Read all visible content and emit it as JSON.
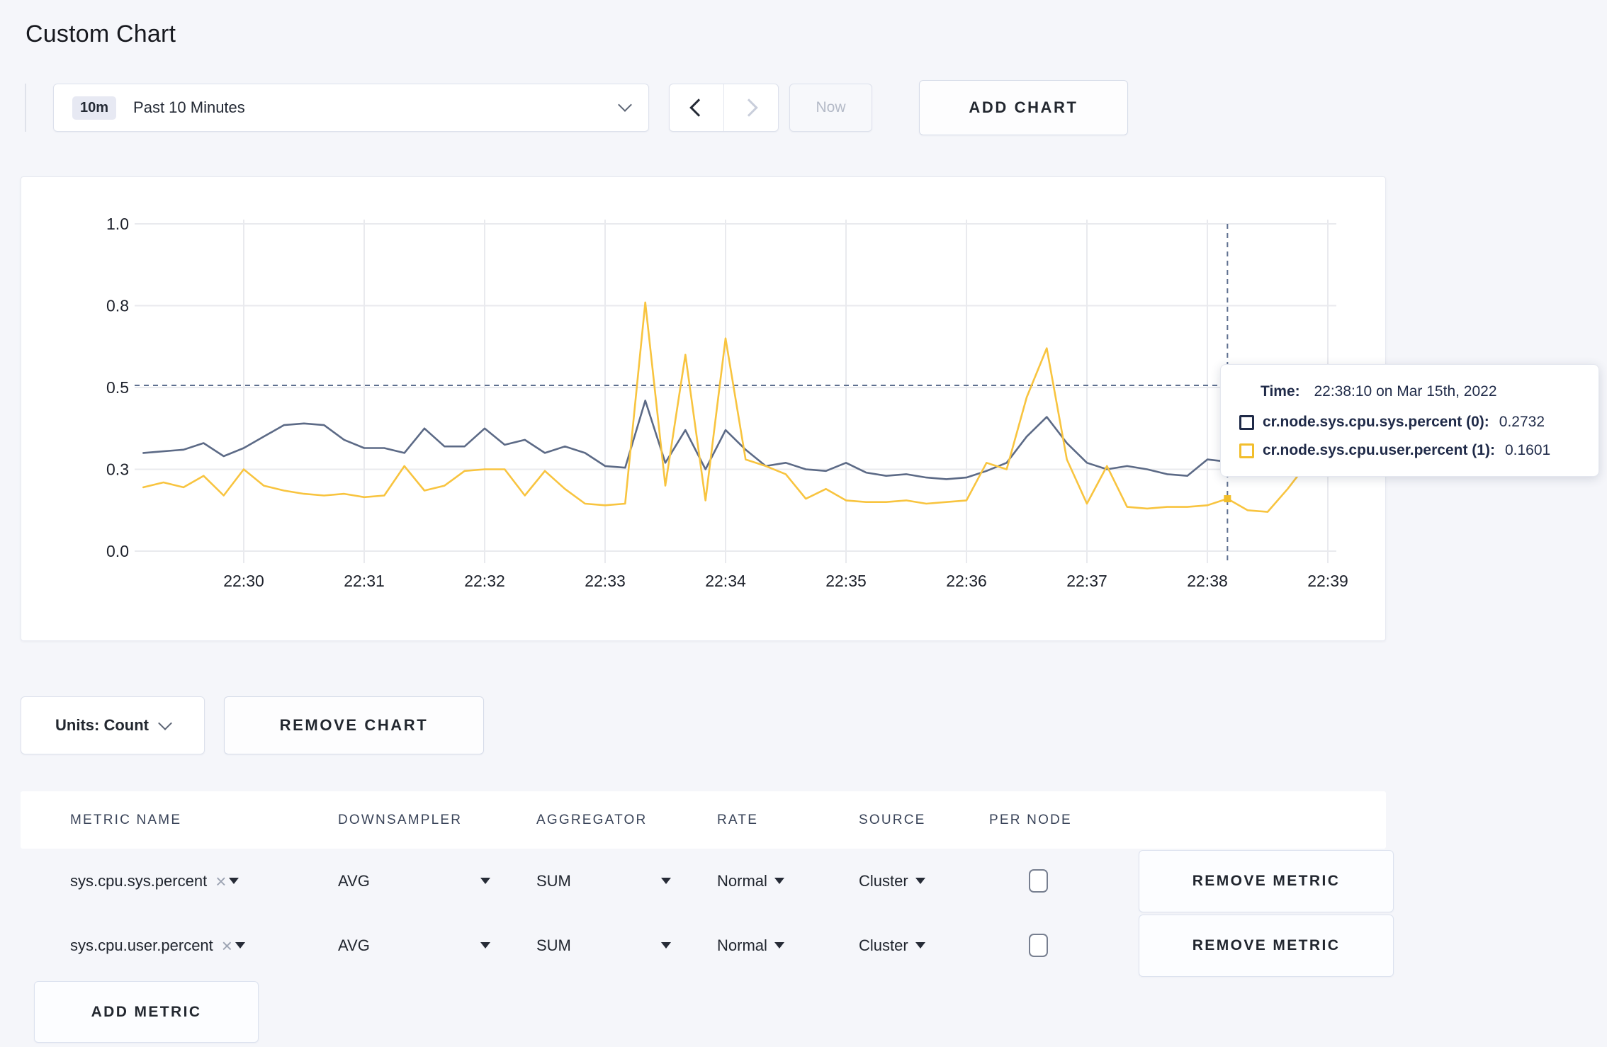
{
  "page": {
    "title": "Custom Chart"
  },
  "colors": {
    "accent_blue": "#2A5CF4",
    "series_sys_line": "#5C6A86",
    "series_sys_legend": "#1F2A48",
    "series_user_line": "#F8C43F",
    "series_user_legend": "#F2BE2C",
    "gridline": "#e9eaee",
    "crosshair": "#5f7090"
  },
  "toolbar": {
    "time_window_badge": "10m",
    "time_window_label": "Past 10 Minutes",
    "prev_icon_name": "chevron-left-icon",
    "next_icon_name": "chevron-right-icon",
    "now_label": "Now",
    "add_chart_label": "ADD CHART"
  },
  "chart": {
    "tooltip": {
      "time_label": "Time:",
      "time_value": "22:38:10 on Mar 15th, 2022",
      "series": [
        {
          "name": "cr.node.sys.cpu.sys.percent (0):",
          "value": "0.2732",
          "color": "#1F2A48"
        },
        {
          "name": "cr.node.sys.cpu.user.percent (1):",
          "value": "0.1601",
          "color": "#F2BE2C"
        }
      ]
    }
  },
  "chart_data": {
    "type": "line",
    "title": "",
    "xlabel": "",
    "ylabel": "",
    "grid": true,
    "legend_position": "tooltip",
    "x_start": "22:29:10",
    "x_interval_seconds": 10,
    "x_first_tick_offset_seconds": 50,
    "x_tick_labels": [
      "22:30",
      "22:31",
      "22:32",
      "22:33",
      "22:34",
      "22:35",
      "22:36",
      "22:37",
      "22:38",
      "22:39"
    ],
    "y_axis": {
      "range": [
        0.0,
        1.0
      ],
      "tick_labels": [
        "1.0",
        "0.8",
        "0.5",
        "0.3",
        "0.0"
      ],
      "tick_values": [
        1.0,
        0.75,
        0.5,
        0.25,
        0.0
      ]
    },
    "series": [
      {
        "name": "cr.node.sys.cpu.sys.percent",
        "color": "#5C6A86",
        "values": [
          0.3,
          0.305,
          0.31,
          0.33,
          0.29,
          0.315,
          0.35,
          0.385,
          0.39,
          0.385,
          0.34,
          0.315,
          0.315,
          0.3,
          0.375,
          0.32,
          0.32,
          0.375,
          0.325,
          0.34,
          0.3,
          0.32,
          0.3,
          0.26,
          0.255,
          0.46,
          0.27,
          0.37,
          0.25,
          0.37,
          0.31,
          0.26,
          0.27,
          0.25,
          0.245,
          0.27,
          0.24,
          0.23,
          0.235,
          0.225,
          0.22,
          0.225,
          0.245,
          0.27,
          0.35,
          0.41,
          0.33,
          0.27,
          0.25,
          0.26,
          0.25,
          0.235,
          0.23,
          0.28,
          0.2732,
          0.265,
          0.27,
          0.28,
          0.29,
          0.3
        ]
      },
      {
        "name": "cr.node.sys.cpu.user.percent",
        "color": "#F8C43F",
        "values": [
          0.195,
          0.21,
          0.195,
          0.23,
          0.17,
          0.25,
          0.2,
          0.185,
          0.175,
          0.17,
          0.175,
          0.165,
          0.17,
          0.26,
          0.185,
          0.2,
          0.245,
          0.25,
          0.25,
          0.17,
          0.245,
          0.19,
          0.145,
          0.14,
          0.145,
          0.76,
          0.2,
          0.6,
          0.155,
          0.65,
          0.28,
          0.26,
          0.235,
          0.16,
          0.19,
          0.155,
          0.15,
          0.15,
          0.155,
          0.145,
          0.15,
          0.155,
          0.27,
          0.25,
          0.47,
          0.62,
          0.28,
          0.145,
          0.26,
          0.135,
          0.13,
          0.135,
          0.135,
          0.14,
          0.1601,
          0.125,
          0.12,
          0.19,
          0.27,
          0.24
        ]
      }
    ],
    "crosshair": {
      "time": "22:38:10",
      "index": 54,
      "hline_value": 0.5065,
      "marker_values": [
        0.2732,
        0.1601
      ]
    }
  },
  "chart_controls": {
    "units_label": "Units: Count",
    "remove_chart_label": "REMOVE CHART"
  },
  "metrics_table": {
    "columns": [
      "METRIC NAME",
      "DOWNSAMPLER",
      "AGGREGATOR",
      "RATE",
      "SOURCE",
      "PER NODE"
    ],
    "rows": [
      {
        "metric_name": "sys.cpu.sys.percent",
        "downsampler": "AVG",
        "aggregator": "SUM",
        "rate": "Normal",
        "source": "Cluster",
        "per_node_checked": false,
        "remove_label": "REMOVE METRIC"
      },
      {
        "metric_name": "sys.cpu.user.percent",
        "downsampler": "AVG",
        "aggregator": "SUM",
        "rate": "Normal",
        "source": "Cluster",
        "per_node_checked": false,
        "remove_label": "REMOVE METRIC"
      }
    ],
    "add_metric_label": "ADD METRIC"
  }
}
